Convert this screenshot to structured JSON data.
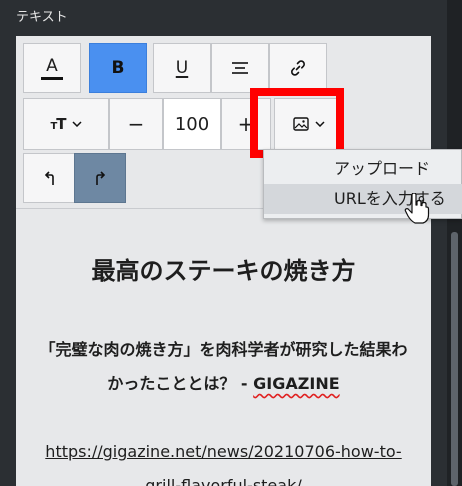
{
  "panel": {
    "title": "テキスト"
  },
  "toolbar": {
    "font_color_letter": "A",
    "bold_letter": "B",
    "underline_letter": "U",
    "font_size_value": "100",
    "minus_symbol": "−",
    "plus_symbol": "+"
  },
  "image_menu": {
    "items": [
      {
        "label": "アップロード"
      },
      {
        "label": "URLを入力する"
      }
    ]
  },
  "content": {
    "heading": "最高のステーキの焼き方",
    "para_line1": "「完璧な肉の焼き方」を肉科学者が研究した結果わ",
    "para_line2_prefix": "かったこととは？ - ",
    "para_line2_site": "GIGAZINE",
    "link_line1": "https://gigazine.net/news/20210706-how-to-",
    "link_line2": "grill-flavorful-steak/"
  },
  "colors": {
    "panel_bg": "#2b2f33",
    "editor_bg": "#e7e8ea",
    "bold_active": "#4a90f0",
    "redo_active": "#6e88a3",
    "highlight": "#ff0000"
  },
  "icons": {
    "font_color": "font-color-icon",
    "bold": "bold-icon",
    "underline": "underline-icon",
    "align": "align-center-icon",
    "link": "link-icon",
    "text_size": "text-size-icon",
    "image": "image-icon",
    "undo": "undo-icon",
    "redo": "redo-icon",
    "cursor": "hand-cursor-icon"
  }
}
